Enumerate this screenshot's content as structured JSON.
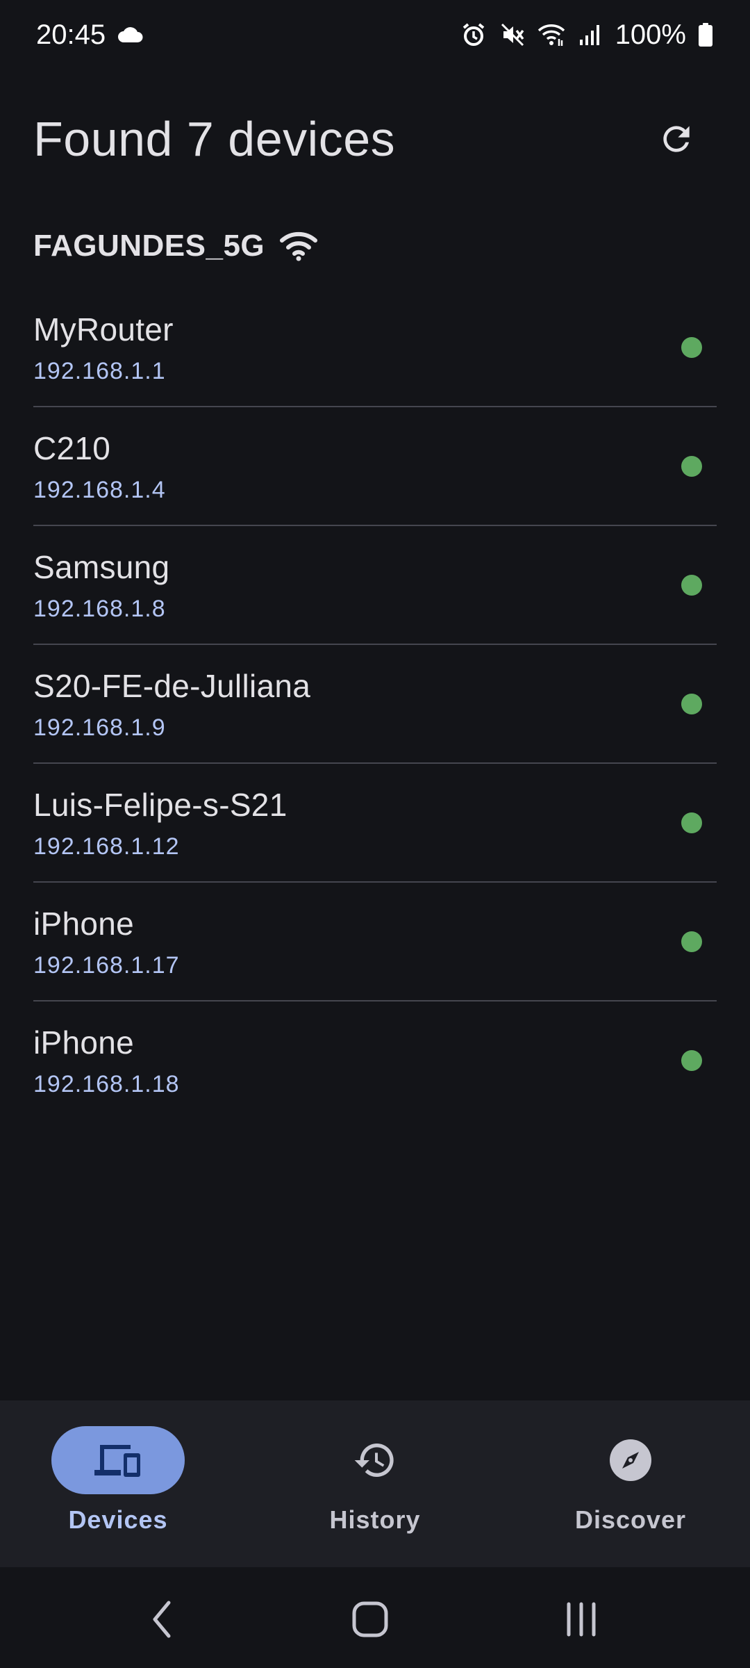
{
  "status_bar": {
    "time": "20:45",
    "battery": "100%",
    "icons": [
      "cloud-icon",
      "alarm-icon",
      "mute-icon",
      "wifi-icon",
      "signal-icon",
      "battery-icon"
    ]
  },
  "header": {
    "title": "Found 7 devices",
    "refresh_icon": "refresh-icon"
  },
  "network": {
    "name": "FAGUNDES_5G",
    "icon": "wifi-icon"
  },
  "devices": [
    {
      "name": "MyRouter",
      "ip": "192.168.1.1",
      "status_color": "#5ea960"
    },
    {
      "name": "C210",
      "ip": "192.168.1.4",
      "status_color": "#5ea960"
    },
    {
      "name": "Samsung",
      "ip": "192.168.1.8",
      "status_color": "#5ea960"
    },
    {
      "name": "S20-FE-de-Julliana",
      "ip": "192.168.1.9",
      "status_color": "#5ea960"
    },
    {
      "name": "Luis-Felipe-s-S21",
      "ip": "192.168.1.12",
      "status_color": "#5ea960"
    },
    {
      "name": "iPhone",
      "ip": "192.168.1.17",
      "status_color": "#5ea960"
    },
    {
      "name": "iPhone",
      "ip": "192.168.1.18",
      "status_color": "#5ea960"
    }
  ],
  "bottom_nav": {
    "items": [
      {
        "label": "Devices",
        "icon": "devices-icon",
        "active": true
      },
      {
        "label": "History",
        "icon": "history-icon",
        "active": false
      },
      {
        "label": "Discover",
        "icon": "compass-icon",
        "active": false
      }
    ]
  },
  "colors": {
    "background": "#131418",
    "accent": "#7b98de",
    "ip_text": "#b3c5f4",
    "online": "#5ea960"
  }
}
